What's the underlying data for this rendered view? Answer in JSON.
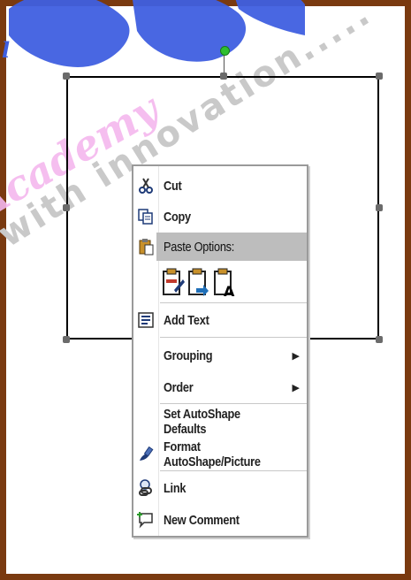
{
  "watermark": {
    "brand_word": "Academy",
    "tagline": "with innovation....."
  },
  "context_menu": {
    "cut": "Cut",
    "copy": "Copy",
    "paste_options": "Paste Options:",
    "add_text": "Add Text",
    "grouping": "Grouping",
    "order": "Order",
    "set_defaults": "Set AutoShape Defaults",
    "format": "Format AutoShape/Picture",
    "link": "Link",
    "new_comment": "New Comment",
    "submenu_arrow": "▶"
  },
  "icons": {
    "cut": "scissors-icon",
    "copy": "copy-icon",
    "paste": "clipboard-icon",
    "add_text": "text-box-icon",
    "format": "format-brush-icon",
    "link": "link-icon",
    "comment": "comment-icon"
  },
  "colors": {
    "frame_border": "#7a3a10",
    "watermark_blue": "#3f5fe0",
    "watermark_pink": "#f5b7ee",
    "menu_highlight": "#bdbdbd",
    "rotation_handle": "#2fbf2f"
  }
}
